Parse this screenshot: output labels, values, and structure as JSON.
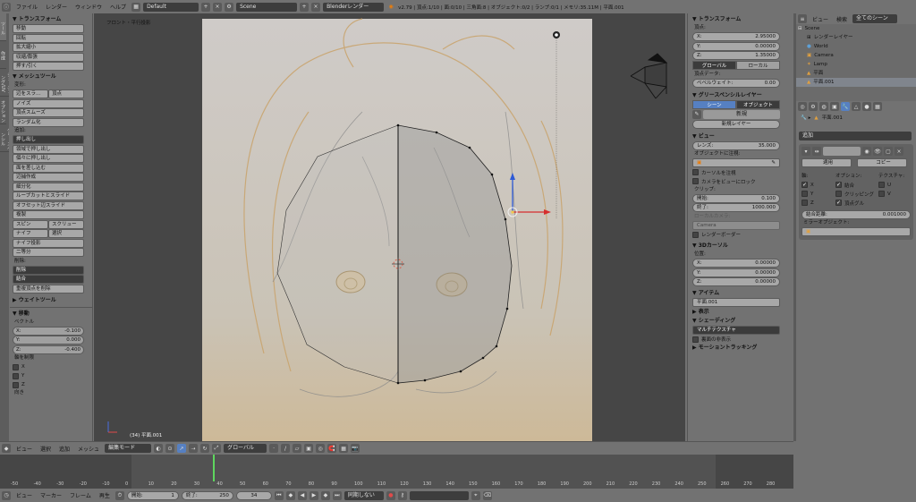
{
  "topbar": {
    "menus": [
      "ファイル",
      "レンダー",
      "ウィンドウ",
      "ヘルプ"
    ],
    "layout": "Default",
    "scene": "Scene",
    "engine": "Blenderレンダー",
    "stats": "v2.79 | 頂点:1/10 | 面:0/10 | 三角面:8 | オブジェクト:0/2 | ランプ:0/1 | メモリ:35.11M | 平面.001"
  },
  "tabs": [
    "ツール",
    "作成",
    "シェーディング/UV",
    "オプション",
    "グリースペンシル"
  ],
  "toolshelf": {
    "transform_title": "▼ トランスフォーム",
    "transform_buttons": [
      "移動",
      "回転",
      "拡大縮小",
      "収縮/膨張",
      "押す/引く"
    ],
    "meshtools_title": "▼ メッシュツール",
    "deform_label": "変形:",
    "deform_row": [
      "辺をスラ...",
      "頂点"
    ],
    "deform_buttons": [
      "ノイズ",
      "頂点スムーズ",
      "ランダム化"
    ],
    "add_label": "追加:",
    "extrude": "押し出し",
    "add_buttons": [
      "領域で押し出し",
      "個々に押し出し",
      "面を差し込む",
      "辺捕作成",
      "細分化",
      "ループカットとスライド",
      "オフセット辺スライド",
      "複製"
    ],
    "spin_row": [
      "スピン",
      "スクリュー"
    ],
    "knife_row": [
      "ナイフ",
      "選択"
    ],
    "knife_project": "ナイフ投影",
    "bisect": "二等分",
    "delete_label": "削除:",
    "delete": "削除",
    "merge": "結合",
    "remove_doubles": "重複頂点を削除",
    "weight_title": "▶ ウェイトツール",
    "move_title": "▼ 移動",
    "vector_label": "ベクトル",
    "vector": [
      [
        "X:",
        "-0.100"
      ],
      [
        "Y:",
        "0.000"
      ],
      [
        "Z:",
        "-0.400"
      ]
    ],
    "constraint_label": "軸を制限",
    "axes": [
      "X",
      "Y",
      "Z"
    ],
    "more": "向き"
  },
  "viewport": {
    "label": "フロント・平行投影",
    "object_label": "(34) 平面.001"
  },
  "npanel": {
    "transform_title": "▼ トランスフォーム",
    "vertex_label": "頂点:",
    "vertex": [
      [
        "X:",
        "2.95000"
      ],
      [
        "Y:",
        "0.00000"
      ],
      [
        "Z:",
        "1.35000"
      ]
    ],
    "space": [
      "グローバル",
      "ローカル"
    ],
    "vertex_data": "頂点データ:",
    "bevel": [
      "ベベルウェイト:",
      "0.00"
    ],
    "gp_title": "▼ グリースペンシルレイヤー",
    "gp_toggle": [
      "シーン",
      "オブジェクト"
    ],
    "gp_new": "新規",
    "gp_new_layer": "新規レイヤー",
    "view_title": "▼ ビュー",
    "lens": [
      "レンズ:",
      "35.000"
    ],
    "lock_label": "オブジェクトに注視:",
    "lock_cursor": "カーソルを注視",
    "lock_camera": "カメラをビューにロック",
    "clip_label": "クリップ:",
    "clip": [
      [
        "開始:",
        "0.100"
      ],
      [
        "終了:",
        "1000.000"
      ]
    ],
    "local_camera": "ローカルカメラ:",
    "camera": "Camera",
    "render_border": "レンダーボーダー",
    "cursor_title": "▼ 3Dカーソル",
    "location_label": "位置:",
    "cursor": [
      [
        "X:",
        "0.00000"
      ],
      [
        "Y:",
        "0.00000"
      ],
      [
        "Z:",
        "0.00000"
      ]
    ],
    "item_title": "▼ アイテム",
    "item_name": "平面.001",
    "display_title": "▶ 表示",
    "shading_title": "▼ シェーディング",
    "shading_mode": "マルチテクスチャ",
    "backface": "裏面の非表示",
    "motion_title": "▶ モーショントラッキング"
  },
  "outliner": {
    "header": [
      "ビュー",
      "検索",
      "全てのシーン"
    ],
    "rows": [
      "Scene",
      "レンダーレイヤー",
      "World",
      "Camera",
      "Lamp",
      "平面",
      "平面.001"
    ]
  },
  "properties": {
    "breadcrumb": "平面.001",
    "modifier_add": "追加",
    "apply": "適用",
    "copy": "コピー",
    "axis": "軸:",
    "options": "オプション:",
    "texture": "テクスチャ:",
    "axis_items": [
      "X",
      "Y",
      "Z"
    ],
    "option_items": [
      "結合",
      "クリッピング",
      "頂点グル"
    ],
    "texture_items": [
      "U",
      "V"
    ],
    "merge_limit": [
      "結合距離:",
      "0.001000"
    ],
    "mirror_object": "ミラーオブジェクト:"
  },
  "vp_header": {
    "menus": [
      "ビュー",
      "選択",
      "追加",
      "メッシュ"
    ],
    "mode": "編集モード",
    "orientation": "グローバル"
  },
  "timeline": {
    "ticks": [
      "-50",
      "-40",
      "-30",
      "-20",
      "-10",
      "0",
      "10",
      "20",
      "30",
      "40",
      "50",
      "60",
      "70",
      "80",
      "90",
      "100",
      "110",
      "120",
      "130",
      "140",
      "150",
      "160",
      "170",
      "180",
      "190",
      "200",
      "210",
      "220",
      "230",
      "240",
      "250",
      "260",
      "270",
      "280"
    ],
    "menus": [
      "ビュー",
      "マーカー",
      "フレーム",
      "再生"
    ],
    "start": [
      "開始:",
      "1"
    ],
    "end": [
      "終了:",
      "250"
    ],
    "current": "34",
    "sync": "同期しない"
  }
}
